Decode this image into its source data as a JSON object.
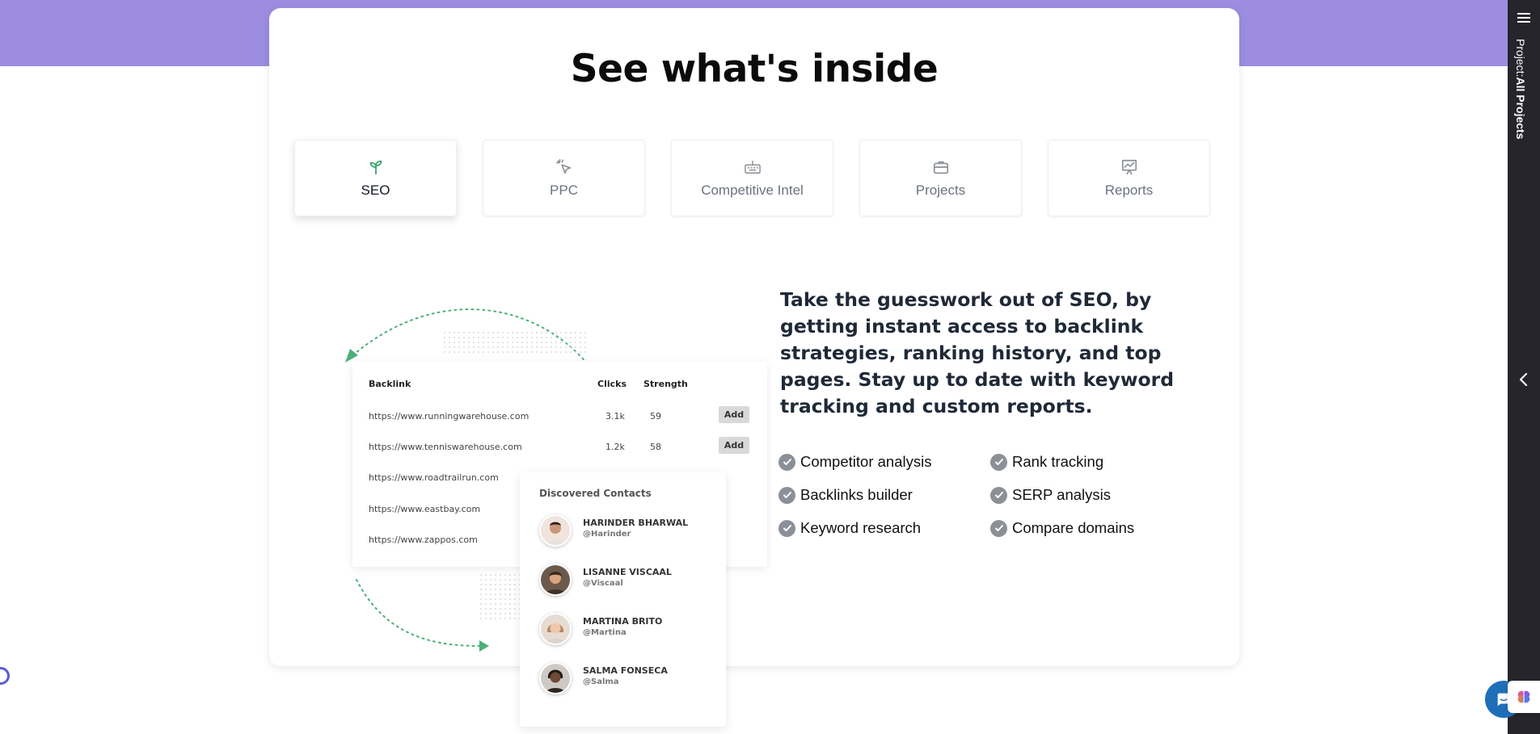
{
  "section": {
    "title": "See what's inside"
  },
  "tabs": [
    {
      "label": "SEO",
      "icon": "sprout-icon",
      "active": true
    },
    {
      "label": "PPC",
      "icon": "cursor-click-icon",
      "active": false
    },
    {
      "label": "Competitive Intel",
      "icon": "keyboard-icon",
      "active": false
    },
    {
      "label": "Projects",
      "icon": "briefcase-icon",
      "active": false
    },
    {
      "label": "Reports",
      "icon": "presentation-chart-icon",
      "active": false
    }
  ],
  "backlinks_table": {
    "headers": {
      "backlink": "Backlink",
      "clicks": "Clicks",
      "strength": "Strength"
    },
    "rows": [
      {
        "url": "https://www.runningwarehouse.com",
        "clicks": "3.1k",
        "strength": "59",
        "action": "Add"
      },
      {
        "url": "https://www.tenniswarehouse.com",
        "clicks": "1.2k",
        "strength": "58",
        "action": "Add"
      },
      {
        "url": "https://www.roadtrailrun.com",
        "clicks": "",
        "strength": "",
        "action": ""
      },
      {
        "url": "https://www.eastbay.com",
        "clicks": "",
        "strength": "",
        "action": ""
      },
      {
        "url": "https://www.zappos.com",
        "clicks": "",
        "strength": "",
        "action": ""
      }
    ]
  },
  "contacts": {
    "title": "Discovered Contacts",
    "items": [
      {
        "name": "HARINDER BHARWAL",
        "handle": "@Harinder"
      },
      {
        "name": "LISANNE VISCAAL",
        "handle": "@Viscaal"
      },
      {
        "name": "MARTINA BRITO",
        "handle": "@Martina"
      },
      {
        "name": "SALMA FONSECA",
        "handle": "@Salma"
      }
    ]
  },
  "description": "Take the guesswork out of SEO, by getting instant access to backlink strategies, ranking history, and top pages. Stay up to date with keyword tracking and custom reports.",
  "features": [
    "Competitor analysis",
    "Rank tracking",
    "Backlinks builder",
    "SERP analysis",
    "Keyword research",
    "Compare domains"
  ],
  "sidebar": {
    "label_prefix": "Project:",
    "label_value": "All Projects"
  },
  "colors": {
    "top_band": "#9d8de0",
    "accent_green": "#4caf7a",
    "sidebar_bg": "#25252b"
  }
}
